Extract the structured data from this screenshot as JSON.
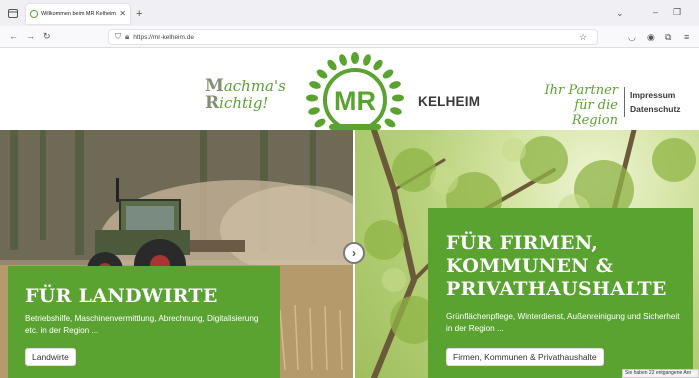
{
  "browser": {
    "tab_title": "Willkommen beim MR Kelheim",
    "tab_close": "✕",
    "new_tab": "+",
    "url": "https://mr-kelheim.de"
  },
  "header": {
    "slogan_left_line1_cap": "M",
    "slogan_left_line1": "achma's",
    "slogan_left_line2_cap": "R",
    "slogan_left_line2": "ichtig!",
    "logo_text": "MR",
    "location": "KELHEIM",
    "slogan_right_line1": "Ihr Partner",
    "slogan_right_line2": "für die Region",
    "links": [
      "Impressum",
      "Datenschutz"
    ]
  },
  "hero": {
    "left": {
      "title": "FÜR LANDWIRTE",
      "description": "Betriebshilfe, Maschinenvermittlung, Abrechnung, Digitalisierung etc. in der Region ...",
      "button": "Landwirte"
    },
    "right": {
      "title_lines": [
        "FÜR FIRMEN,",
        "KOMMUNEN &",
        "PRIVATHAUSHALTE"
      ],
      "description": "Grünflächenpflege, Winterdienst, Außenreinigung und Sicherheit in der Region ...",
      "button": "Firmen, Kommunen & Privathaushalte"
    }
  },
  "toast": "Sie haben 22 entgangene Anr",
  "colors": {
    "brand_green": "#5aa331",
    "text_dark": "#3a3a3a"
  }
}
